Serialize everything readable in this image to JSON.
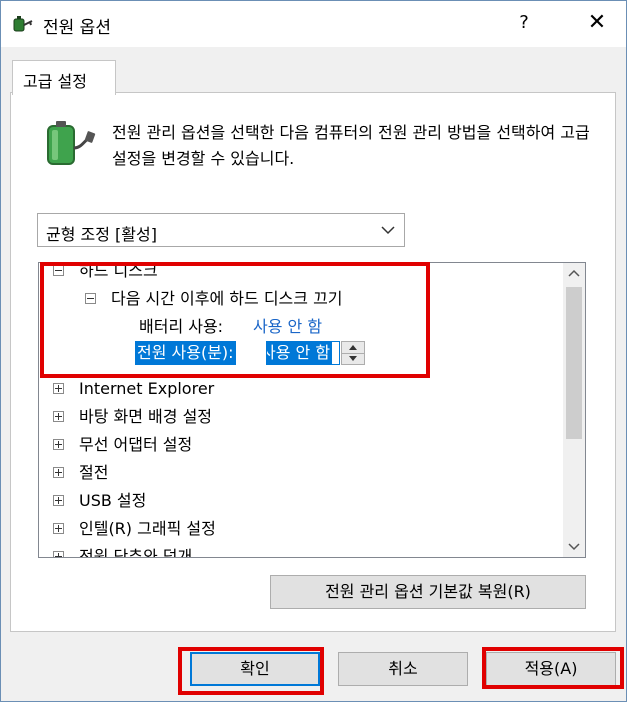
{
  "window": {
    "title": "전원 옵션",
    "help_label": "?",
    "close_label": "✕"
  },
  "tab": {
    "label": "고급 설정"
  },
  "description": "전원 관리 옵션을 선택한 다음 컴퓨터의 전원 관리 방법을 선택하여 고급 설정을 변경할 수 있습니다.",
  "plan_select": {
    "selected": "균형 조정 [활성]"
  },
  "tree": {
    "hard_disk": "하드 디스크",
    "turn_off_after": "다음 시간 이후에 하드 디스크 끄기",
    "battery_label": "배터리 사용:",
    "battery_value": "사용 안 함",
    "plugged_label": "전원 사용(분):",
    "plugged_value": "사용 안 함",
    "items": [
      "Internet Explorer",
      "바탕 화면 배경 설정",
      "무선 어댑터 설정",
      "절전",
      "USB 설정",
      "인텔(R) 그래픽 설정",
      "전원 단추와 덮개"
    ]
  },
  "restore_button": "전원 관리 옵션 기본값 복원(R)",
  "buttons": {
    "ok": "확인",
    "cancel": "취소",
    "apply": "적용(A)"
  },
  "colors": {
    "highlight": "#e00000",
    "selection": "#0078d7",
    "link": "#1a66c8"
  },
  "icons": {
    "app": "battery-plug-icon",
    "power": "battery-plug-icon",
    "dropdown": "chevron-down-icon"
  }
}
